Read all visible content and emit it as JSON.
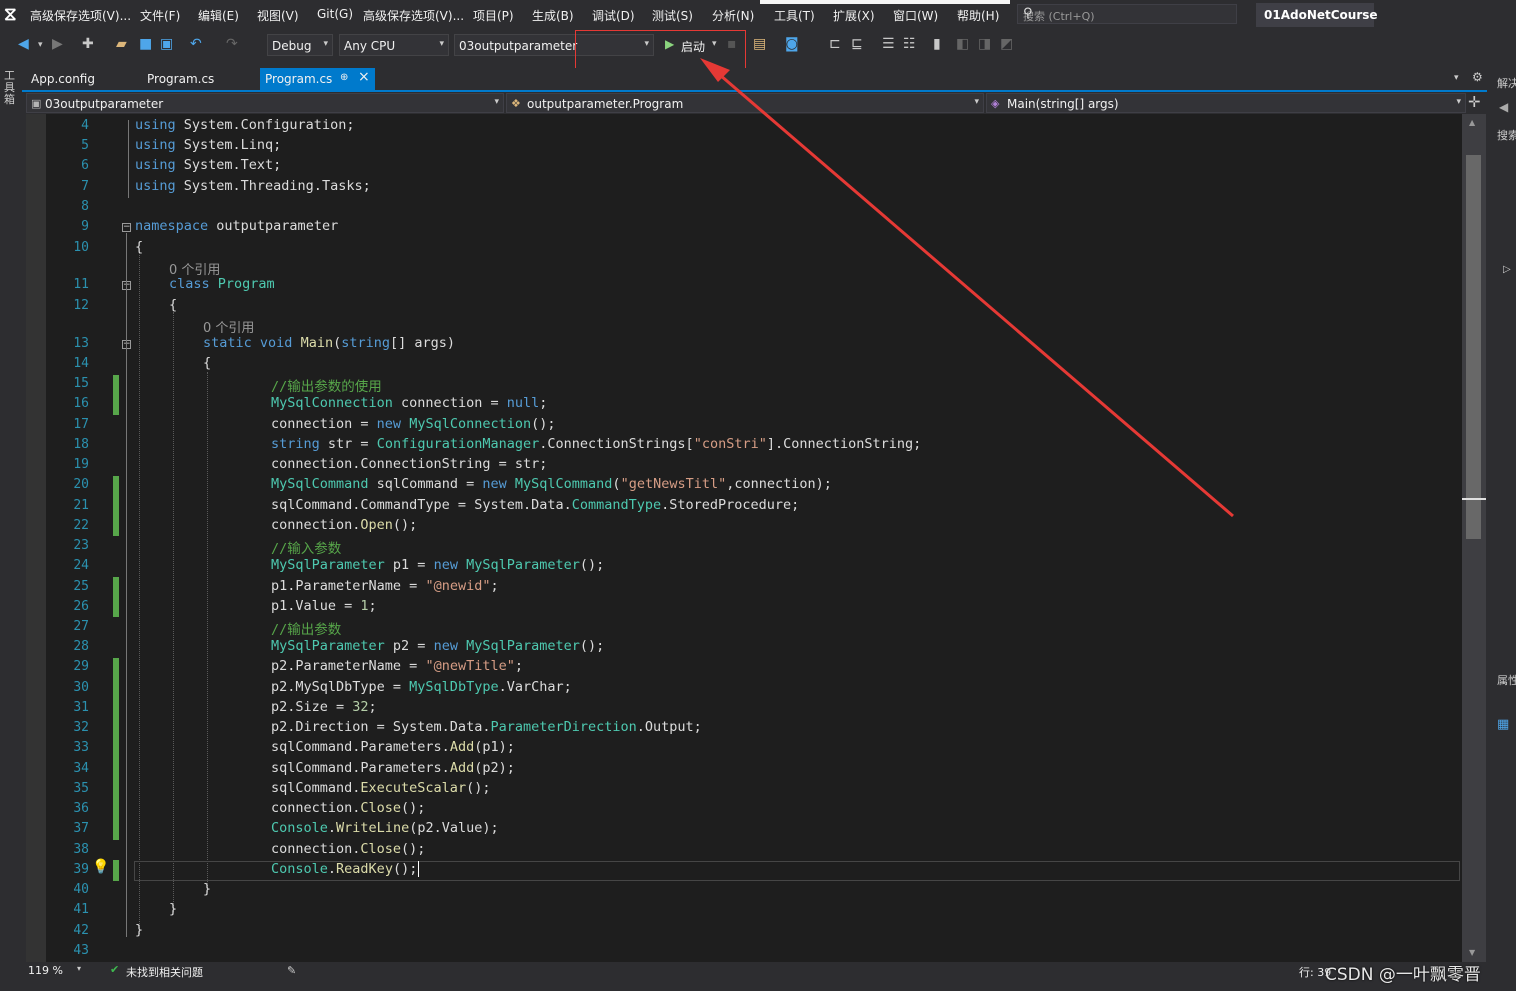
{
  "menu": {
    "items": [
      "高级保存选项(V)...",
      "文件(F)",
      "编辑(E)",
      "视图(V)",
      "Git(G)",
      "高级保存选项(V)...",
      "项目(P)",
      "生成(B)",
      "调试(D)",
      "测试(S)",
      "分析(N)",
      "工具(T)",
      "扩展(X)",
      "窗口(W)",
      "帮助(H)"
    ],
    "search_placeholder": "搜索 (Ctrl+Q)",
    "solution_name": "01AdoNetCourse"
  },
  "toolbar": {
    "config": "Debug",
    "platform": "Any CPU",
    "startup_project": "03outputparameter",
    "start_label": "启动"
  },
  "tabs": [
    {
      "label": "App.config"
    },
    {
      "label": "Program.cs"
    },
    {
      "label": "Program.cs",
      "pin": "⊕",
      "close": "×"
    }
  ],
  "navbar": {
    "project": "03outputparameter",
    "class": "outputparameter.Program",
    "member": "Main(string[] args)"
  },
  "left_strip_label": "工具箱",
  "right_panel": {
    "top": "解决",
    "search": "搜索",
    "props": "属性"
  },
  "code": {
    "line_numbers": [
      "4",
      "5",
      "6",
      "7",
      "8",
      "9",
      "10",
      "11",
      "12",
      "13",
      "14",
      "15",
      "16",
      "17",
      "18",
      "19",
      "20",
      "21",
      "22",
      "23",
      "24",
      "25",
      "26",
      "27",
      "28",
      "29",
      "30",
      "31",
      "32",
      "33",
      "34",
      "35",
      "36",
      "37",
      "38",
      "39",
      "40",
      "41",
      "42",
      "43"
    ],
    "codelens": [
      "0 个引用",
      "0 个引用"
    ]
  },
  "status": {
    "zoom": "119 %",
    "issues": "未找到相关问题",
    "position": "行: 39",
    "watermark": "CSDN @一叶飘零晋"
  },
  "colors": {
    "accent": "#007acc",
    "keyword": "#569cd6",
    "type": "#4ec9b0",
    "string": "#d69d85",
    "comment": "#57a64a",
    "annotation": "#e53935"
  }
}
